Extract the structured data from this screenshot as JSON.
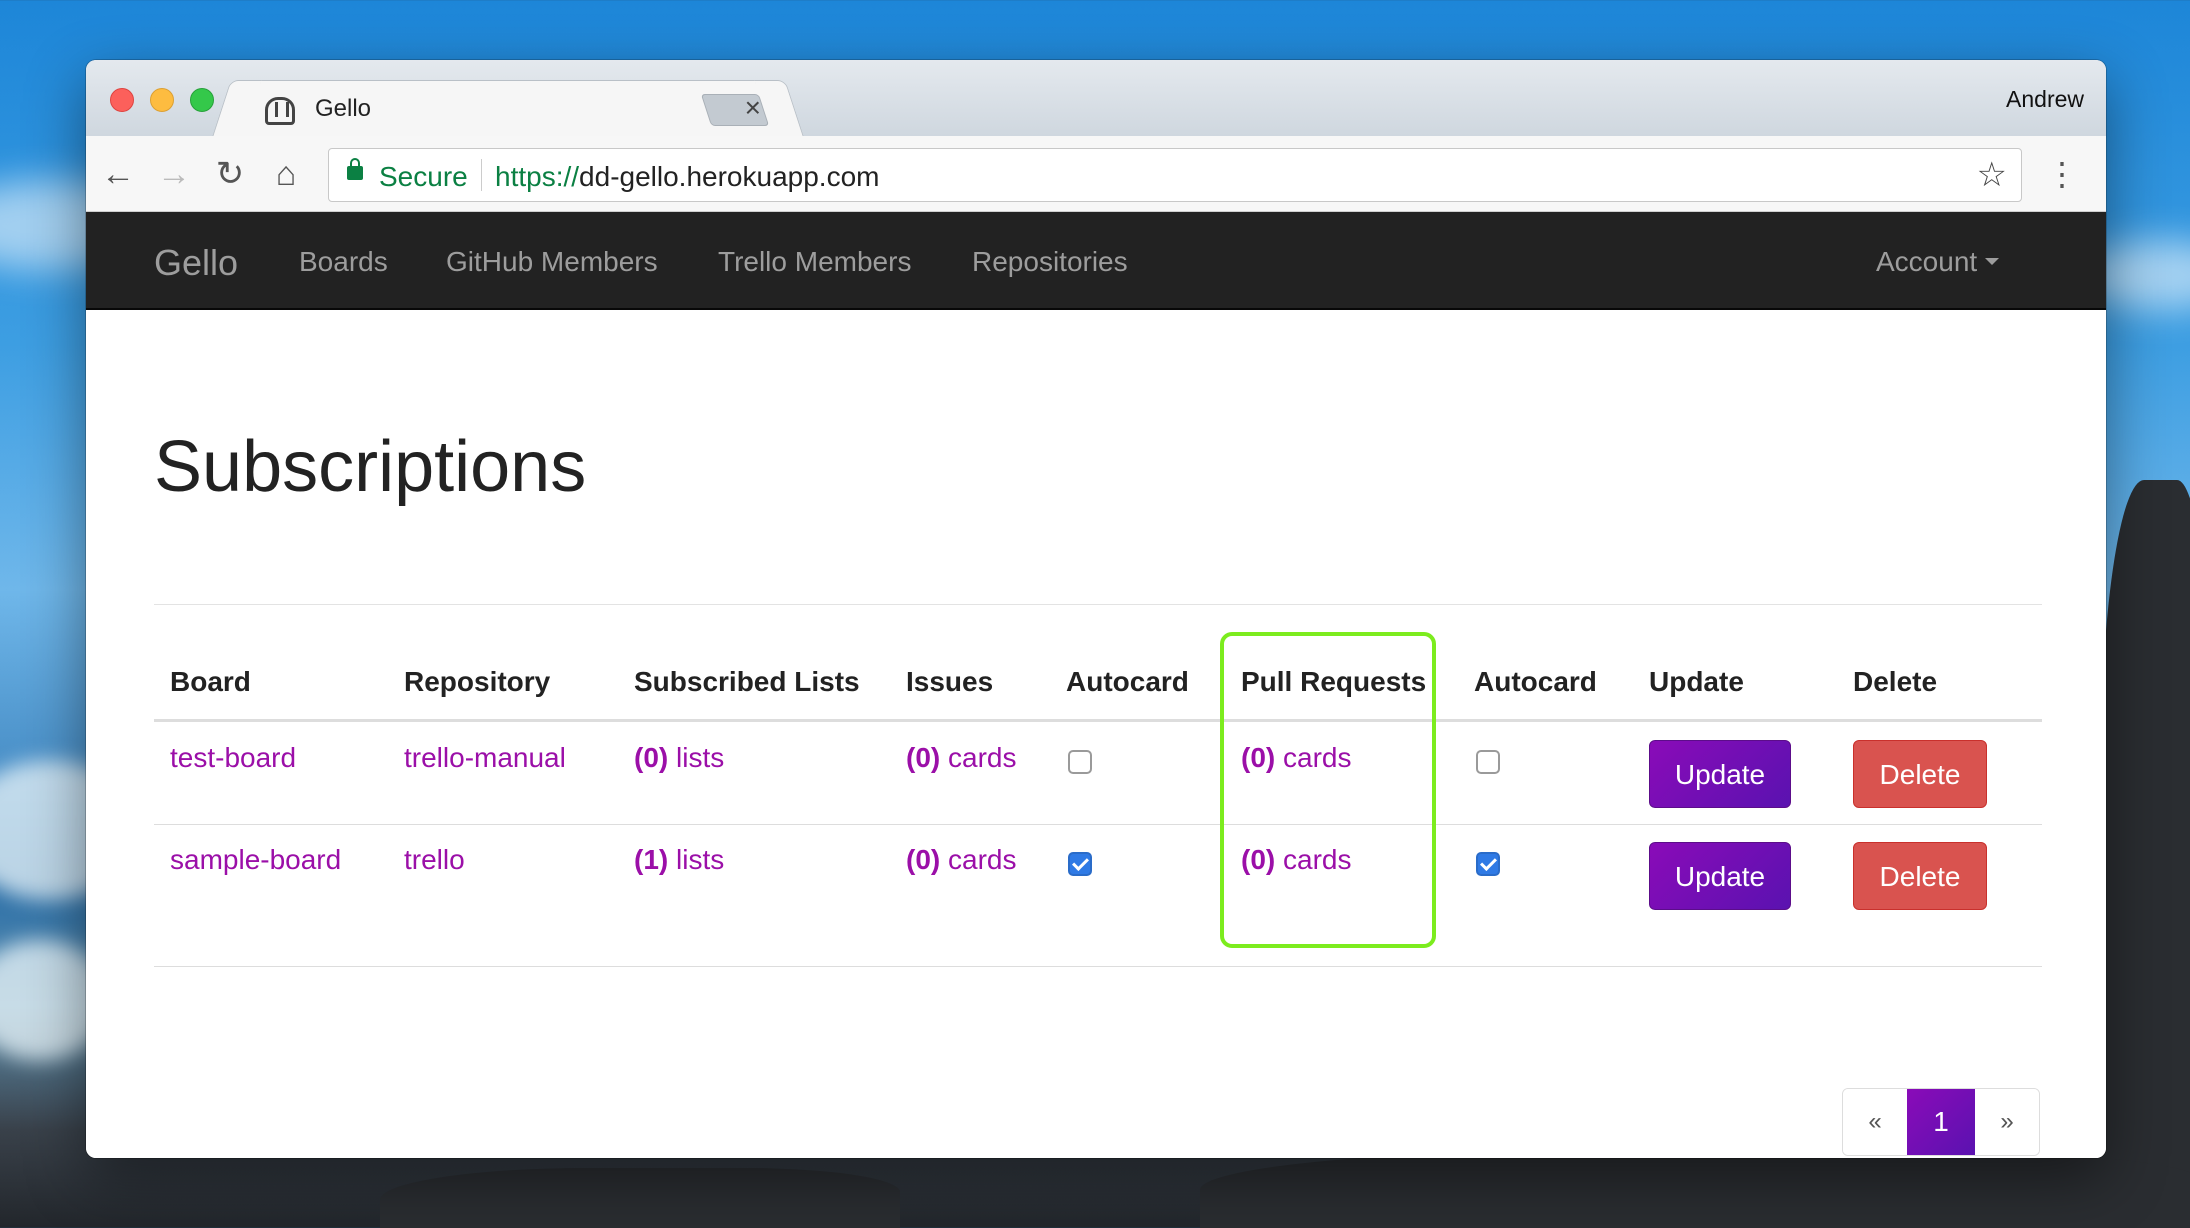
{
  "browser": {
    "tab_title": "Gello",
    "tab_close": "×",
    "profile_name": "Andrew",
    "secure_label": "Secure",
    "url_scheme": "https://",
    "url_host": "dd-gello.herokuapp.com",
    "back_icon": "←",
    "forward_icon": "→",
    "reload_icon": "↻",
    "home_icon": "⌂",
    "star_icon": "☆",
    "menu_icon": "⋮"
  },
  "navbar": {
    "brand": "Gello",
    "links": [
      "Boards",
      "GitHub Members",
      "Trello Members",
      "Repositories"
    ],
    "account": "Account"
  },
  "page": {
    "title": "Subscriptions",
    "columns": [
      "Board",
      "Repository",
      "Subscribed Lists",
      "Issues",
      "Autocard",
      "Pull Requests",
      "Autocard",
      "Update",
      "Delete"
    ],
    "rows": [
      {
        "board": "test-board",
        "repository": "trello-manual",
        "lists_count": "(0)",
        "lists_label": "lists",
        "issues_count": "(0)",
        "issues_label": "cards",
        "issues_autocard": false,
        "prs_count": "(0)",
        "prs_label": "cards",
        "prs_autocard": false,
        "update_label": "Update",
        "delete_label": "Delete"
      },
      {
        "board": "sample-board",
        "repository": "trello",
        "lists_count": "(1)",
        "lists_label": "lists",
        "issues_count": "(0)",
        "issues_label": "cards",
        "issues_autocard": true,
        "prs_count": "(0)",
        "prs_label": "cards",
        "prs_autocard": true,
        "update_label": "Update",
        "delete_label": "Delete"
      }
    ],
    "pagination": {
      "prev": "«",
      "current": "1",
      "next": "»"
    }
  },
  "colors": {
    "link": "#9b0fa8",
    "update_button": "#7a0cb5",
    "delete_button": "#d9534f",
    "navbar": "#222222",
    "highlight_box": "#7cec1e",
    "checkbox_checked": "#2f7ae5"
  }
}
